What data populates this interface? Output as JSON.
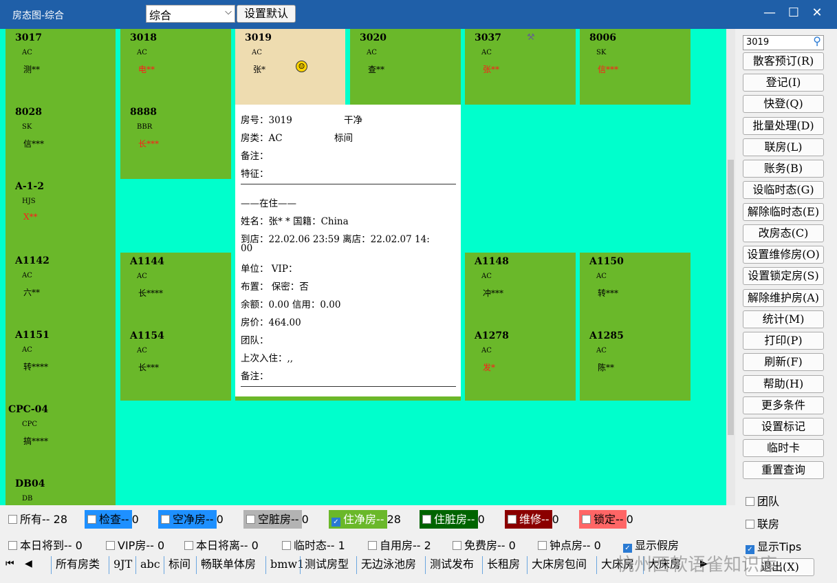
{
  "titlebar": {
    "title": "房态图-综合",
    "view_select": "综合",
    "set_default": "设置默认"
  },
  "rooms": [
    {
      "no": "3017",
      "type": "AC",
      "guest": "测**",
      "guest_color": "black"
    },
    {
      "no": "3018",
      "type": "AC",
      "guest": "电**",
      "guest_color": "red"
    },
    {
      "no": "3019",
      "type": "AC",
      "guest": "张*",
      "guest_color": "black",
      "selected": true
    },
    {
      "no": "3020",
      "type": "AC",
      "guest": "查**",
      "guest_color": "black"
    },
    {
      "no": "3037",
      "type": "AC",
      "guest": "张**",
      "guest_color": "red"
    },
    {
      "no": "8006",
      "type": "SK",
      "guest": "信***",
      "guest_color": "red"
    },
    {
      "no": "8028",
      "type": "SK",
      "guest": "信***",
      "guest_color": "black"
    },
    {
      "no": "8888",
      "type": "BBR",
      "guest": "长***",
      "guest_color": "red"
    },
    {
      "no": "A-1-2",
      "type": "HJS",
      "guest": "X**",
      "guest_color": "red"
    },
    {
      "no": "A1142",
      "type": "AC",
      "guest": "六**",
      "guest_color": "black"
    },
    {
      "no": "A1144",
      "type": "AC",
      "guest": "长****",
      "guest_color": "black"
    },
    {
      "no": "A1148",
      "type": "AC",
      "guest": "冲***",
      "guest_color": "black"
    },
    {
      "no": "A1150",
      "type": "AC",
      "guest": "转***",
      "guest_color": "black"
    },
    {
      "no": "A1151",
      "type": "AC",
      "guest": "转****",
      "guest_color": "black"
    },
    {
      "no": "A1154",
      "type": "AC",
      "guest": "长***",
      "guest_color": "black"
    },
    {
      "no": "A1278",
      "type": "AC",
      "guest": "发*",
      "guest_color": "red"
    },
    {
      "no": "A1285",
      "type": "AC",
      "guest": "陈**",
      "guest_color": "black"
    },
    {
      "no": "CPC-04",
      "type": "CPC",
      "guest": "搞****",
      "guest_color": "black"
    },
    {
      "no": "DB04",
      "type": "DB",
      "guest": "",
      "guest_color": "black"
    }
  ],
  "tooltip": {
    "room_line": "房号：3019",
    "status": "干净",
    "type_line": "房类：AC",
    "type_name": "标间",
    "note1": "备注：",
    "feature": "特征：",
    "section": "——在住——",
    "name_line": "姓名：张* * 国籍：China",
    "arrive_line": "到店：22.02.06 23:59  离店：22.02.07 14:",
    "arrive_cont": "00",
    "unit": "单位：  VIP：",
    "layout": "布置：  保密：否",
    "balance": "余额：0.00  信用：0.00",
    "price": "房价：464.00",
    "team": "团队：",
    "last_stay": "上次入住：,,",
    "note2": "备注："
  },
  "sidebar": {
    "search_value": "3019",
    "buttons": [
      "散客预订(R)",
      "登记(I)",
      "快登(Q)",
      "批量处理(D)",
      "联房(L)",
      "账务(B)",
      "设临时态(G)",
      "解除临时态(E)",
      "改房态(C)",
      "设置维修房(O)",
      "设置锁定房(S)",
      "解除维护房(A)",
      "统计(M)",
      "打印(P)",
      "刷新(F)",
      "帮助(H)",
      "更多条件",
      "设置标记",
      "临时卡",
      "重置查询"
    ],
    "checks": [
      {
        "label": "团队",
        "checked": false
      },
      {
        "label": "联房",
        "checked": false
      },
      {
        "label": "显示Tips",
        "checked": true
      }
    ],
    "exit": "退出(X)"
  },
  "legend": {
    "all": "所有-- 28",
    "items": [
      {
        "label": "检查--",
        "count": "0",
        "bg": "#1e90ff",
        "fg": "#000000"
      },
      {
        "label": "空净房--",
        "count": "0",
        "bg": "#1e90ff",
        "fg": "#000000"
      },
      {
        "label": "空脏房--",
        "count": "0",
        "bg": "#b3b3b3",
        "fg": "#000000"
      },
      {
        "label": "住净房--",
        "count": "28",
        "bg": "#6ab82a",
        "fg": "#ffffff",
        "checked": true
      },
      {
        "label": "住脏房--",
        "count": "0",
        "bg": "#006400",
        "fg": "#ffffff"
      },
      {
        "label": "维修--",
        "count": "0",
        "bg": "#8b0000",
        "fg": "#ffffff"
      },
      {
        "label": "锁定--",
        "count": "0",
        "bg": "#ff6666",
        "fg": "#000000"
      }
    ]
  },
  "filters": [
    {
      "label": "本日将到-- 0",
      "checked": false
    },
    {
      "label": "VIP房-- 0",
      "checked": false
    },
    {
      "label": "本日将离-- 0",
      "checked": false
    },
    {
      "label": "临时态-- 1",
      "checked": false
    },
    {
      "label": "自用房-- 2",
      "checked": false
    },
    {
      "label": "免费房-- 0",
      "checked": false
    },
    {
      "label": "钟点房-- 0",
      "checked": false
    },
    {
      "label": "显示假房",
      "checked": true
    }
  ],
  "tabs": [
    "所有房类",
    "9JT",
    "abc",
    "标间",
    "畅联单体房",
    "bmw1",
    "测试房型",
    "无边泳池房",
    "测试发布",
    "长租房",
    "大床房包间",
    "大床房",
    "大床房"
  ],
  "watermark": "杭州西软语雀知识库"
}
